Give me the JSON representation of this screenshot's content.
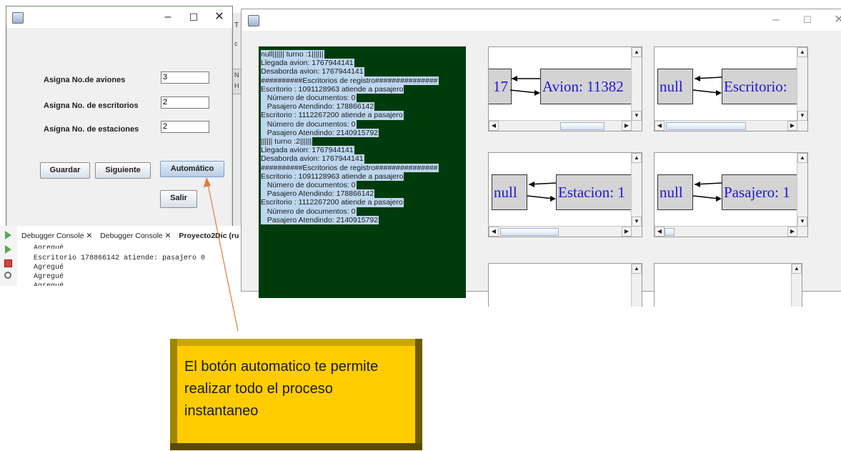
{
  "setup_window": {
    "controls": {
      "minimize": "–",
      "maximize": "☐",
      "close": "✕"
    },
    "fields": [
      {
        "label": "Asigna No.de aviones",
        "value": "3"
      },
      {
        "label": "Asigna No. de escritorios",
        "value": "2"
      },
      {
        "label": "Asigna No. de estaciones",
        "value": "2"
      }
    ],
    "buttons": {
      "guardar": "Guardar",
      "siguiente": "Siguiente",
      "automatico": "Automático",
      "salir": "Salir"
    }
  },
  "console": {
    "tabs": [
      "Debugger Console ✕",
      "Debugger Console ✕",
      "Proyecto2Dic (ru"
    ],
    "lines": [
      "Agregué",
      "Escritorio 178866142 atiende: pasajero 0",
      "Agregué",
      "Agregué",
      "Agregué"
    ]
  },
  "background_window": {
    "edge_letters": [
      "T",
      "c",
      "N",
      "H"
    ]
  },
  "sim_window": {
    "controls": {
      "minimize": "–",
      "maximize": "☐",
      "close": "✕"
    },
    "log_lines": [
      "null|||||| turno :1||||||",
      "Llegada avion: 1767944141",
      "Desaborda avion: 1767944141",
      "##########Escritorios de registro###############",
      "Escritorio : 1091128963 atiende a pasajero",
      "   Número de documentos: 0",
      "   Pasajero Atendindo: 178866142",
      "Escritorio : 1112267200 atiende a pasajero",
      "   Número de documentos: 0",
      "   Pasajero Atendindo: 2140915792",
      "|||||| turno :2||||||",
      "Llegada avion: 1767944141",
      "Desaborda avion: 1767944141",
      "##########Escritorios de registro###############",
      "Escritorio : 1091128963 atiende a pasajero",
      "   Número de documentos: 0",
      "   Pasajero Atendindo: 178866142",
      "Escritorio : 1112267200 atiende a pasajero",
      "   Número de documentos: 0",
      "   Pasajero Atendindo: 2140915792"
    ],
    "panels": [
      {
        "left": "17",
        "right": "Avion: 11382"
      },
      {
        "left": "null",
        "right": "Escritorio:"
      },
      {
        "left": "null",
        "right": "Estacion: 1"
      },
      {
        "left": "null",
        "right": "Pasajero: 1"
      }
    ]
  },
  "callout": {
    "text": "El botón automatico te permite realizar todo el proceso instantaneo"
  },
  "colors": {
    "log_bg": "#003b0c",
    "log_highlight": "#bdd7ef",
    "callout_fill": "#ffcc00",
    "node_text": "#1f16d4",
    "arrow_line": "#e07a40"
  }
}
